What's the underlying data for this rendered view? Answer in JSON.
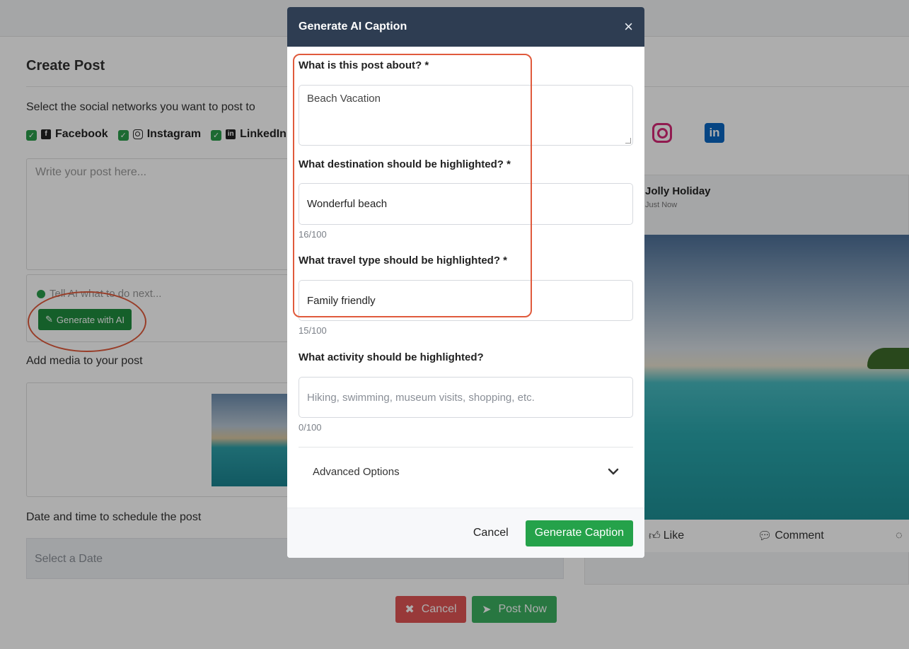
{
  "page": {
    "title": "Create Post",
    "select_networks_label": "Select the social networks you want to post to",
    "networks": [
      {
        "label": "Facebook",
        "checked": true,
        "icon": "facebook-icon"
      },
      {
        "label": "Instagram",
        "checked": true,
        "icon": "instagram-icon"
      },
      {
        "label": "LinkedIn",
        "checked": true,
        "icon": "linkedin-icon"
      }
    ],
    "post_placeholder": "Write your post here...",
    "ai_prompt_placeholder": "Tell AI what to do next...",
    "generate_ai_label": "Generate with AI",
    "media_label": "Add media to your post",
    "date_label": "Date and time to schedule the post",
    "date_placeholder": "Select a Date",
    "cancel_label": "Cancel",
    "post_now_label": "Post Now"
  },
  "preview": {
    "account_name": "Jolly Holiday",
    "time": "Just Now",
    "like_label": "Like",
    "comment_label": "Comment"
  },
  "modal": {
    "title": "Generate AI Caption",
    "close_symbol": "×",
    "fields": {
      "about": {
        "label": "What is this post about? *",
        "value": "Beach Vacation"
      },
      "destination": {
        "label": "What destination should be highlighted? *",
        "value": "Wonderful beach",
        "counter": "16/100"
      },
      "travel_type": {
        "label": "What travel type should be highlighted? *",
        "value": "Family friendly",
        "counter": "15/100"
      },
      "activity": {
        "label": "What activity should be highlighted?",
        "placeholder": "Hiking, swimming, museum visits, shopping, etc.",
        "counter": "0/100"
      }
    },
    "advanced_options_label": "Advanced Options",
    "cancel_label": "Cancel",
    "generate_label": "Generate Caption"
  },
  "colors": {
    "modal_header": "#2e3d52",
    "primary_green": "#25a24a",
    "danger_red": "#e05555",
    "annotation_red": "#e05a3c"
  }
}
